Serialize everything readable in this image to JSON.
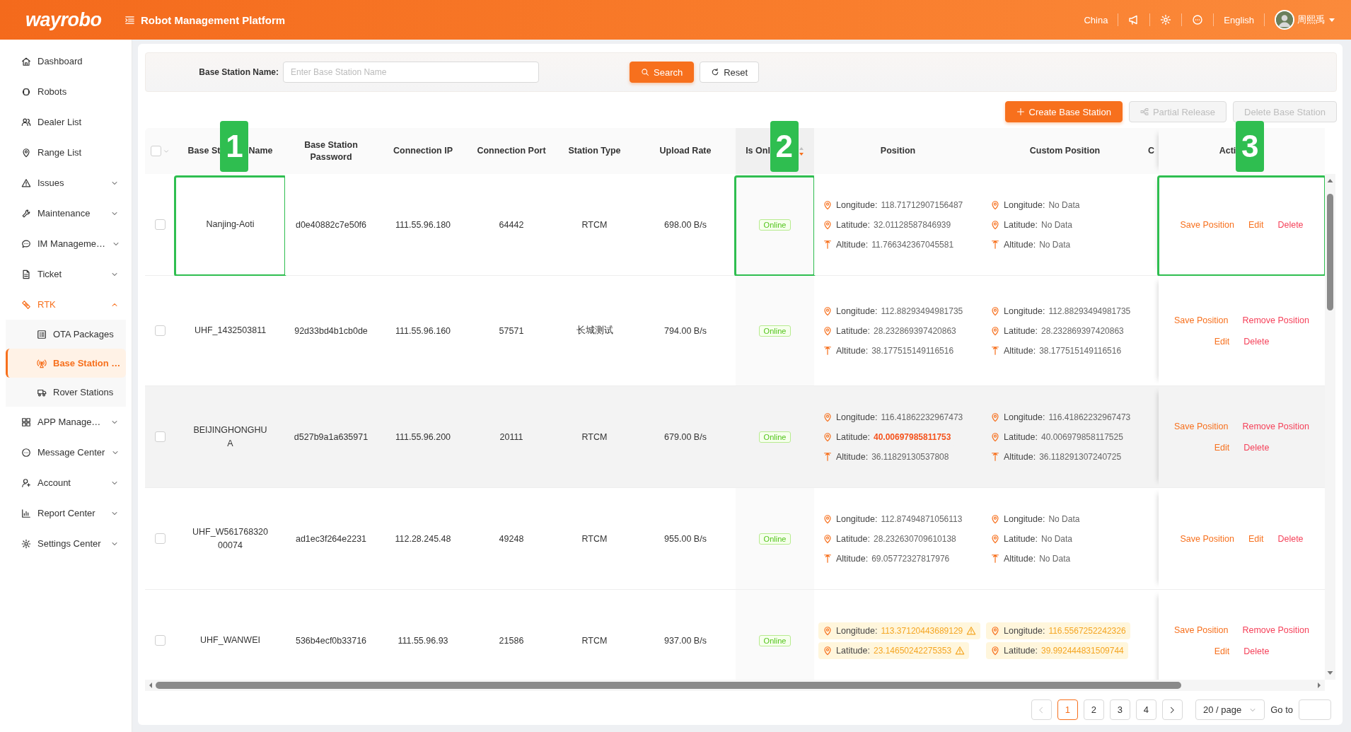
{
  "header": {
    "logo": "wayrobo",
    "title": "Robot Management Platform",
    "region": "China",
    "language": "English",
    "user_name": "周熙禹"
  },
  "sidebar": {
    "items": [
      {
        "label": "Dashboard",
        "kind": "link",
        "selected": false
      },
      {
        "label": "Robots",
        "kind": "link",
        "selected": false
      },
      {
        "label": "Dealer List",
        "kind": "link",
        "selected": false
      },
      {
        "label": "Range List",
        "kind": "link",
        "selected": false
      },
      {
        "label": "Issues",
        "kind": "group",
        "expanded": false,
        "selected": false
      },
      {
        "label": "Maintenance",
        "kind": "group",
        "expanded": false,
        "selected": false
      },
      {
        "label": "IM Manageme…",
        "kind": "group",
        "expanded": false,
        "selected": false
      },
      {
        "label": "Ticket",
        "kind": "group",
        "expanded": false,
        "selected": false
      },
      {
        "label": "RTK",
        "kind": "group",
        "expanded": true,
        "selected": true,
        "children": [
          {
            "label": "OTA Packages",
            "selected": false
          },
          {
            "label": "Base Station …",
            "selected": true
          },
          {
            "label": "Rover Stations",
            "selected": false
          }
        ]
      },
      {
        "label": "APP Manage…",
        "kind": "group",
        "expanded": false,
        "selected": false
      },
      {
        "label": "Message Center",
        "kind": "group",
        "expanded": false,
        "selected": false
      },
      {
        "label": "Account",
        "kind": "group",
        "expanded": false,
        "selected": false
      },
      {
        "label": "Report Center",
        "kind": "group",
        "expanded": false,
        "selected": false
      },
      {
        "label": "Settings Center",
        "kind": "group",
        "expanded": false,
        "selected": false
      }
    ]
  },
  "search": {
    "label": "Base Station Name:",
    "placeholder": "Enter Base Station Name",
    "buttons": [
      {
        "label": "Search",
        "kind": "primary"
      },
      {
        "label": "Reset",
        "kind": "default"
      }
    ]
  },
  "toolbar": [
    {
      "label": "Create Base Station",
      "kind": "primary",
      "disabled": false
    },
    {
      "label": "Partial Release",
      "kind": "default",
      "disabled": true
    },
    {
      "label": "Delete Base Station",
      "kind": "default",
      "disabled": true
    }
  ],
  "table": {
    "select_all": {
      "checked": false
    },
    "columns": [
      {
        "label": "Base St",
        "label_after": "Name"
      },
      {
        "label": "Base Station Password"
      },
      {
        "label": "Connection IP"
      },
      {
        "label": "Connection Port"
      },
      {
        "label": "Station Type"
      },
      {
        "label": "Upload Rate"
      },
      {
        "label": "Is Onl",
        "sorted_descending": true
      },
      {
        "label": "Position"
      },
      {
        "label": "Custom Position"
      },
      {
        "label": "C"
      },
      {
        "label": "Acti"
      }
    ],
    "rows": [
      {
        "checked": false,
        "hovered": false,
        "name": "Nanjing-Aoti",
        "password": "d0e40882c7e50f6",
        "ip": "111.55.96.180",
        "port": "64442",
        "type": "RTCM",
        "upload_rate": "698.00 B/s",
        "status": "Online",
        "position": [
          {
            "kind": "longitude",
            "label": "Longitude:",
            "value": "118.71712907156487",
            "mismatch": false,
            "flagged": false,
            "warning": false
          },
          {
            "kind": "latitude",
            "label": "Latitude:",
            "value": "32.01128587846939",
            "mismatch": false,
            "flagged": false,
            "warning": false
          },
          {
            "kind": "altitude",
            "label": "Altitude:",
            "value": "11.766342367045581",
            "mismatch": false,
            "flagged": false,
            "warning": false
          }
        ],
        "custom_position": [
          {
            "kind": "longitude",
            "label": "Longitude:",
            "value": "No Data",
            "mismatch": false,
            "flagged": false,
            "warning": false
          },
          {
            "kind": "latitude",
            "label": "Latitude:",
            "value": "No Data",
            "mismatch": false,
            "flagged": false,
            "warning": false
          },
          {
            "kind": "altitude",
            "label": "Altitude:",
            "value": "No Data",
            "mismatch": false,
            "flagged": false,
            "warning": false
          }
        ],
        "actions": [
          {
            "label": "Save Position",
            "kind": "primary"
          },
          {
            "label": "Edit",
            "kind": "primary"
          },
          {
            "label": "Delete",
            "kind": "danger"
          }
        ]
      },
      {
        "checked": false,
        "hovered": false,
        "name": "UHF_1432503811",
        "password": "92d33bd4b1cb0de",
        "ip": "111.55.96.160",
        "port": "57571",
        "type": "长城测试",
        "upload_rate": "794.00 B/s",
        "status": "Online",
        "position": [
          {
            "kind": "longitude",
            "label": "Longitude:",
            "value": "112.88293494981735",
            "mismatch": false,
            "flagged": false,
            "warning": false
          },
          {
            "kind": "latitude",
            "label": "Latitude:",
            "value": "28.232869397420863",
            "mismatch": false,
            "flagged": false,
            "warning": false
          },
          {
            "kind": "altitude",
            "label": "Altitude:",
            "value": "38.177515149116516",
            "mismatch": false,
            "flagged": false,
            "warning": false
          }
        ],
        "custom_position": [
          {
            "kind": "longitude",
            "label": "Longitude:",
            "value": "112.88293494981735",
            "mismatch": false,
            "flagged": false,
            "warning": false
          },
          {
            "kind": "latitude",
            "label": "Latitude:",
            "value": "28.232869397420863",
            "mismatch": false,
            "flagged": false,
            "warning": false
          },
          {
            "kind": "altitude",
            "label": "Altitude:",
            "value": "38.177515149116516",
            "mismatch": false,
            "flagged": false,
            "warning": false
          }
        ],
        "actions": [
          {
            "label": "Save Position",
            "kind": "primary"
          },
          {
            "label": "Remove Position",
            "kind": "danger"
          },
          {
            "label": "Edit",
            "kind": "primary"
          },
          {
            "label": "Delete",
            "kind": "danger"
          }
        ]
      },
      {
        "checked": false,
        "hovered": true,
        "name": "BEIJINGHONGHUA",
        "password": "d527b9a1a635971",
        "ip": "111.55.96.200",
        "port": "20111",
        "type": "RTCM",
        "upload_rate": "679.00 B/s",
        "status": "Online",
        "position": [
          {
            "kind": "longitude",
            "label": "Longitude:",
            "value": "116.41862232967473",
            "mismatch": false,
            "flagged": false,
            "warning": false
          },
          {
            "kind": "latitude",
            "label": "Latitude:",
            "value": "40.00697985811753",
            "mismatch": true,
            "flagged": false,
            "warning": false
          },
          {
            "kind": "altitude",
            "label": "Altitude:",
            "value": "36.11829130537808",
            "mismatch": false,
            "flagged": false,
            "warning": false
          }
        ],
        "custom_position": [
          {
            "kind": "longitude",
            "label": "Longitude:",
            "value": "116.41862232967473",
            "mismatch": false,
            "flagged": false,
            "warning": false
          },
          {
            "kind": "latitude",
            "label": "Latitude:",
            "value": "40.006979858117525",
            "mismatch": false,
            "flagged": false,
            "warning": false
          },
          {
            "kind": "altitude",
            "label": "Altitude:",
            "value": "36.118291307240725",
            "mismatch": false,
            "flagged": false,
            "warning": false
          }
        ],
        "actions": [
          {
            "label": "Save Position",
            "kind": "primary"
          },
          {
            "label": "Remove Position",
            "kind": "danger"
          },
          {
            "label": "Edit",
            "kind": "primary"
          },
          {
            "label": "Delete",
            "kind": "danger"
          }
        ]
      },
      {
        "checked": false,
        "hovered": false,
        "name": "UHF_W56176832000074",
        "password": "ad1ec3f264e2231",
        "ip": "112.28.245.48",
        "port": "49248",
        "type": "RTCM",
        "upload_rate": "955.00 B/s",
        "status": "Online",
        "position": [
          {
            "kind": "longitude",
            "label": "Longitude:",
            "value": "112.87494871056113",
            "mismatch": false,
            "flagged": false,
            "warning": false
          },
          {
            "kind": "latitude",
            "label": "Latitude:",
            "value": "28.232630709610138",
            "mismatch": false,
            "flagged": false,
            "warning": false
          },
          {
            "kind": "altitude",
            "label": "Altitude:",
            "value": "69.05772327817976",
            "mismatch": false,
            "flagged": false,
            "warning": false
          }
        ],
        "custom_position": [
          {
            "kind": "longitude",
            "label": "Longitude:",
            "value": "No Data",
            "mismatch": false,
            "flagged": false,
            "warning": false
          },
          {
            "kind": "latitude",
            "label": "Latitude:",
            "value": "No Data",
            "mismatch": false,
            "flagged": false,
            "warning": false
          },
          {
            "kind": "altitude",
            "label": "Altitude:",
            "value": "No Data",
            "mismatch": false,
            "flagged": false,
            "warning": false
          }
        ],
        "actions": [
          {
            "label": "Save Position",
            "kind": "primary"
          },
          {
            "label": "Edit",
            "kind": "primary"
          },
          {
            "label": "Delete",
            "kind": "danger"
          }
        ]
      },
      {
        "checked": false,
        "hovered": false,
        "name": "UHF_WANWEI",
        "password": "536b4ecf0b33716",
        "ip": "111.55.96.93",
        "port": "21586",
        "type": "RTCM",
        "upload_rate": "937.00 B/s",
        "status": "Online",
        "position": [
          {
            "kind": "longitude",
            "label": "Longitude:",
            "value": "113.37120443689129",
            "mismatch": false,
            "flagged": true,
            "warning": true
          },
          {
            "kind": "latitude",
            "label": "Latitude:",
            "value": "23.14650242275353",
            "mismatch": false,
            "flagged": true,
            "warning": true
          }
        ],
        "custom_position": [
          {
            "kind": "longitude",
            "label": "Longitude:",
            "value": "116.5567252242326",
            "mismatch": false,
            "flagged": true,
            "warning": false
          },
          {
            "kind": "latitude",
            "label": "Latitude:",
            "value": "39.992444831509744",
            "mismatch": false,
            "flagged": true,
            "warning": false
          }
        ],
        "actions": [
          {
            "label": "Save Position",
            "kind": "primary"
          },
          {
            "label": "Remove Position",
            "kind": "danger"
          },
          {
            "label": "Edit",
            "kind": "primary"
          },
          {
            "label": "Delete",
            "kind": "danger"
          }
        ]
      }
    ]
  },
  "pagination": {
    "prev_disabled": true,
    "next_disabled": false,
    "pages": [
      {
        "label": "1",
        "selected": true
      },
      {
        "label": "2",
        "selected": false
      },
      {
        "label": "3",
        "selected": false
      },
      {
        "label": "4",
        "selected": false
      }
    ],
    "page_size": "20 / page",
    "goto_label": "Go to"
  },
  "callouts": [
    {
      "label": "1"
    },
    {
      "label": "2"
    },
    {
      "label": "3"
    }
  ]
}
